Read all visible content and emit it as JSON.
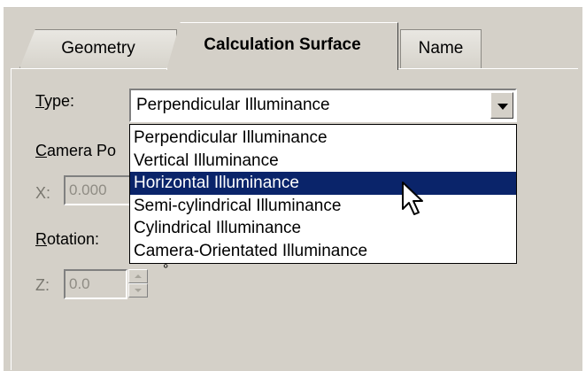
{
  "tabs": [
    {
      "label": "Geometry"
    },
    {
      "label": "Calculation Surface"
    },
    {
      "label": "Name"
    }
  ],
  "type_label_first": "T",
  "type_label_rest": "ype:",
  "type_select": {
    "value": "Perpendicular Illuminance",
    "options": [
      "Perpendicular Illuminance",
      "Vertical Illuminance",
      "Horizontal Illuminance",
      "Semi-cylindrical Illuminance",
      "Cylindrical Illuminance",
      "Camera-Orientated Illuminance"
    ],
    "highlighted": "Horizontal Illuminance"
  },
  "camera_label_first": "C",
  "camera_label_rest": "amera Po",
  "x_label": "X:",
  "x_value": "0.000",
  "rotation_label_first": "R",
  "rotation_label_rest": "otation:",
  "z_label": "Z:",
  "z_value": "0.0",
  "degree_symbol": "°",
  "colors": {
    "highlight": "#0a246a",
    "panel": "#d4d0c8"
  }
}
